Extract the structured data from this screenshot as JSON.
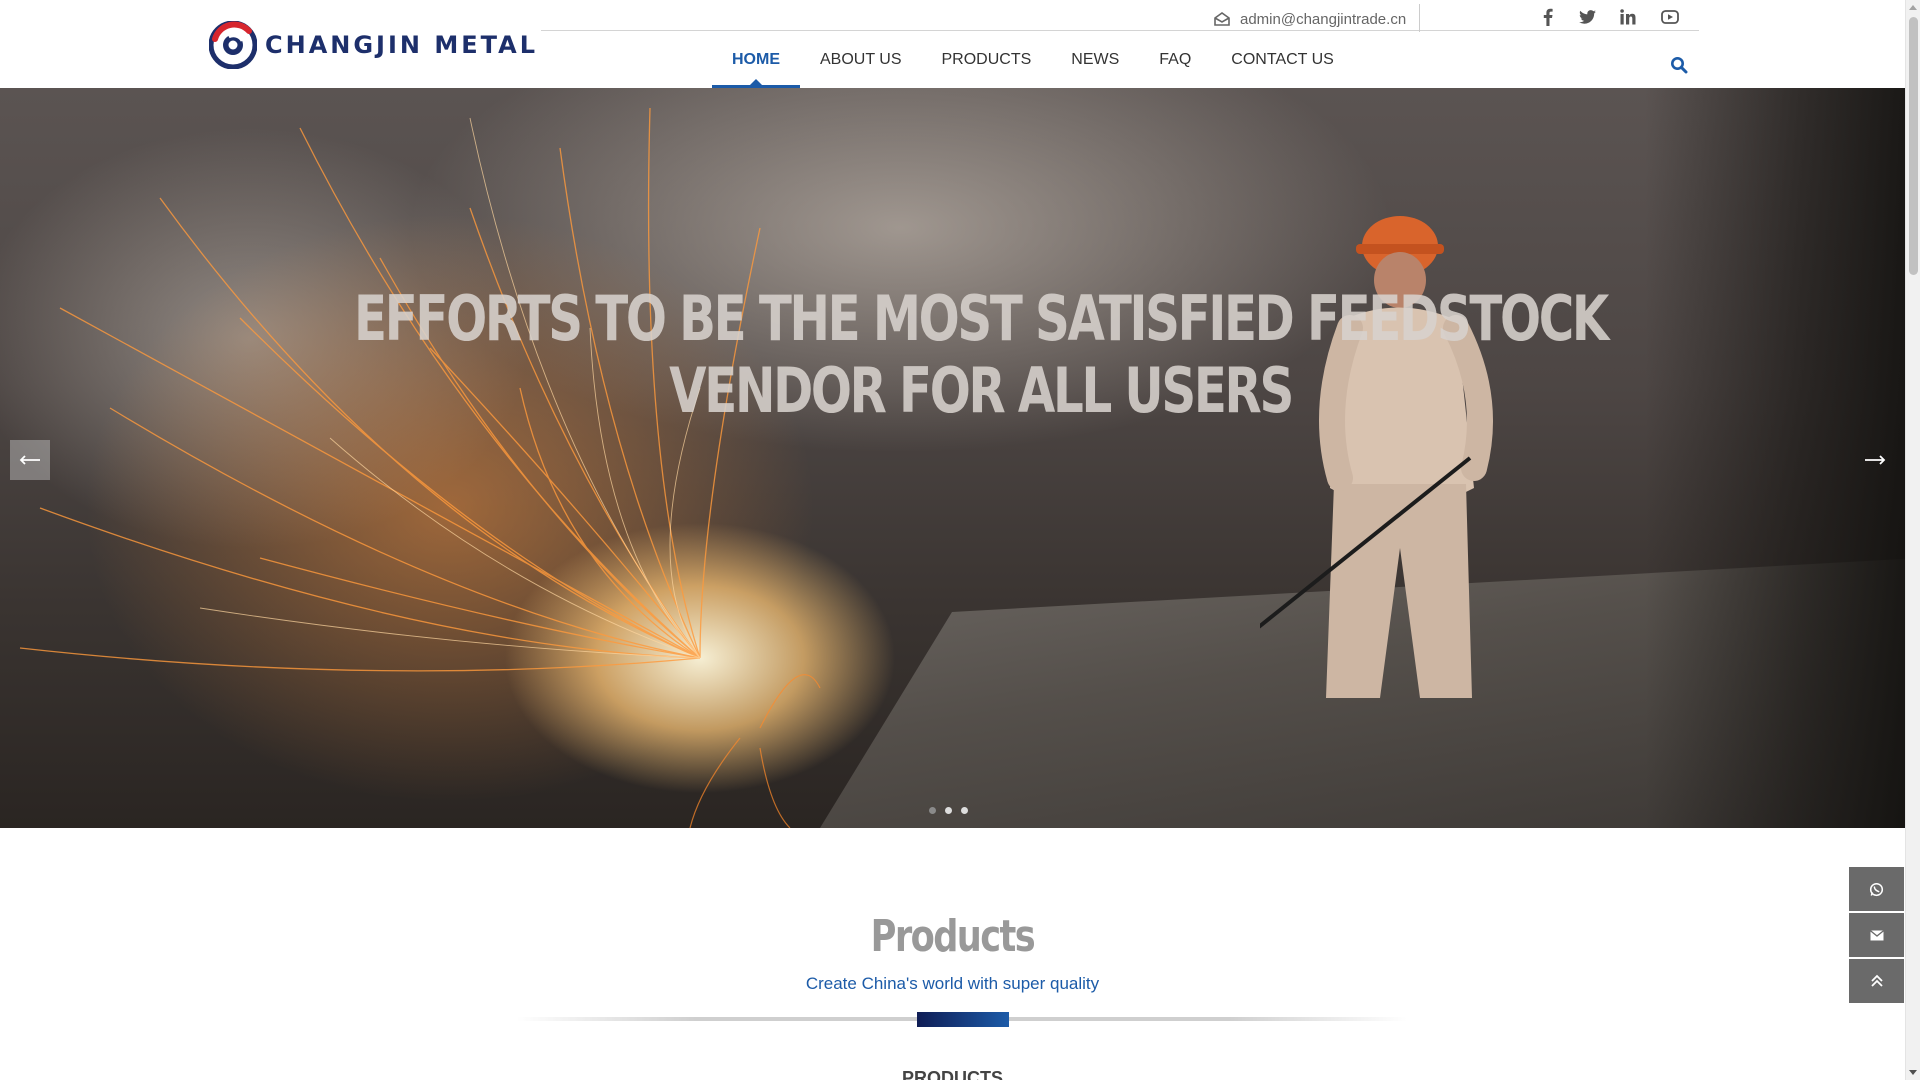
{
  "brand": {
    "name": "CHANGJIN METAL",
    "color_primary": "#1d2f6b",
    "color_accent": "#d7262e"
  },
  "topbar": {
    "email": "admin@changjintrade.cn",
    "email_icon": "envelope-open-icon",
    "social": [
      "facebook-icon",
      "twitter-icon",
      "linkedin-icon",
      "youtube-icon"
    ]
  },
  "nav": {
    "items": [
      {
        "label": "HOME",
        "active": true
      },
      {
        "label": "ABOUT US",
        "active": false
      },
      {
        "label": "PRODUCTS",
        "active": false
      },
      {
        "label": "NEWS",
        "active": false
      },
      {
        "label": "FAQ",
        "active": false
      },
      {
        "label": "CONTACT US",
        "active": false
      }
    ],
    "active_color": "#1c5ba8",
    "search_icon": "search-icon"
  },
  "hero": {
    "title_line1": "EFFORTS TO BE THE MOST SATISFIED FEEDSTOCK",
    "title_line2": "VENDOR FOR ALL USERS",
    "slide_count": 3,
    "current_slide": 1
  },
  "products": {
    "title": "Products",
    "subtitle": "Create China's world with super quality",
    "label": "PRODUCTS"
  },
  "float_buttons": [
    "whatsapp-icon",
    "email-icon",
    "back-to-top-icon"
  ]
}
